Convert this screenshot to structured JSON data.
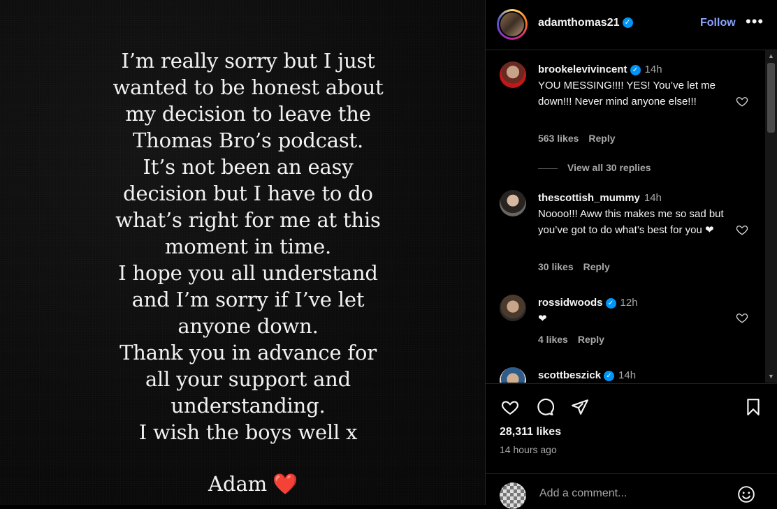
{
  "post": {
    "lines": [
      "I’m really sorry but I just",
      "wanted to be honest about",
      "my decision to leave the",
      "Thomas Bro’s podcast.",
      "It’s not been an easy",
      "decision but I have to do",
      "what’s right for me at this",
      "moment in time.",
      "I hope you all understand",
      "and I’m sorry if I’ve let",
      "anyone down.",
      "Thank you in advance for",
      "all your support and",
      "understanding.",
      "I wish the boys well x"
    ],
    "signature": "Adam",
    "signature_heart": "❤️"
  },
  "header": {
    "username": "adamthomas21",
    "verified_mark": "✓",
    "follow_label": "Follow",
    "more_label": "•••"
  },
  "comments": [
    {
      "user": "brookelevivincent",
      "verified": true,
      "time": "14h",
      "text": "YOU MESSING!!!! YES! You’ve let me down!!! Never mind anyone else!!!",
      "likes": "563 likes",
      "reply": "Reply",
      "view_replies": "View all 30 replies"
    },
    {
      "user": "thescottish_mummy",
      "verified": false,
      "time": "14h",
      "text": "Noooo!!! Aww this makes me so sad but you’ve got to do what’s best for you",
      "heart": "❤",
      "likes": "30 likes",
      "reply": "Reply"
    },
    {
      "user": "rossidwoods",
      "verified": true,
      "time": "12h",
      "heart": "❤",
      "likes": "4 likes",
      "reply": "Reply"
    },
    {
      "user": "scottbeszick",
      "verified": true,
      "time": "14h"
    }
  ],
  "actions": {
    "likes": "28,311 likes",
    "time_ago": "14 hours ago"
  },
  "add_comment": {
    "placeholder": "Add a comment..."
  },
  "colors": {
    "accent_follow": "#8aa4ff",
    "verified_blue": "#0095f6",
    "heart_red": "#ff3040"
  }
}
